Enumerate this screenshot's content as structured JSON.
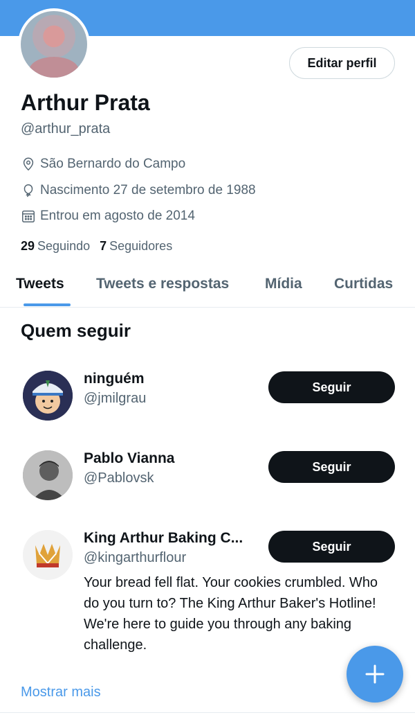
{
  "profile": {
    "name": "Arthur Prata",
    "handle": "@arthur_prata",
    "edit_label": "Editar perfil",
    "location": "São Bernardo do Campo",
    "birthday": "Nascimento 27 de setembro de 1988",
    "joined": "Entrou em agosto de 2014",
    "following_count": "29",
    "following_label": "Seguindo",
    "followers_count": "7",
    "followers_label": "Seguidores",
    "icons": [
      "location-icon",
      "balloon-icon",
      "calendar-icon"
    ]
  },
  "tabs": [
    {
      "label": "Tweets",
      "active": true
    },
    {
      "label": "Tweets e respostas",
      "active": false
    },
    {
      "label": "Mídia",
      "active": false
    },
    {
      "label": "Curtidas",
      "active": false
    }
  ],
  "who_to_follow": {
    "title": "Quem seguir",
    "follow_label": "Seguir",
    "accounts": [
      {
        "name": "ninguém",
        "handle": "@jmilgrau",
        "bio": ""
      },
      {
        "name": "Pablo Vianna",
        "handle": "@Pablovsk",
        "bio": ""
      },
      {
        "name": "King Arthur Baking C...",
        "handle": "@kingarthurflour",
        "bio": "Your bread fell flat. Your cookies crumbled. Who do you turn to? The King Arthur Baker's Hotline! We're here to guide you through any baking challenge."
      }
    ],
    "show_more": "Mostrar mais"
  },
  "fab": {
    "icon": "plus-icon"
  },
  "colors": {
    "accent": "#4a99e9",
    "text": "#0f1419",
    "secondary": "#536471",
    "button_dark": "#0f1419"
  }
}
